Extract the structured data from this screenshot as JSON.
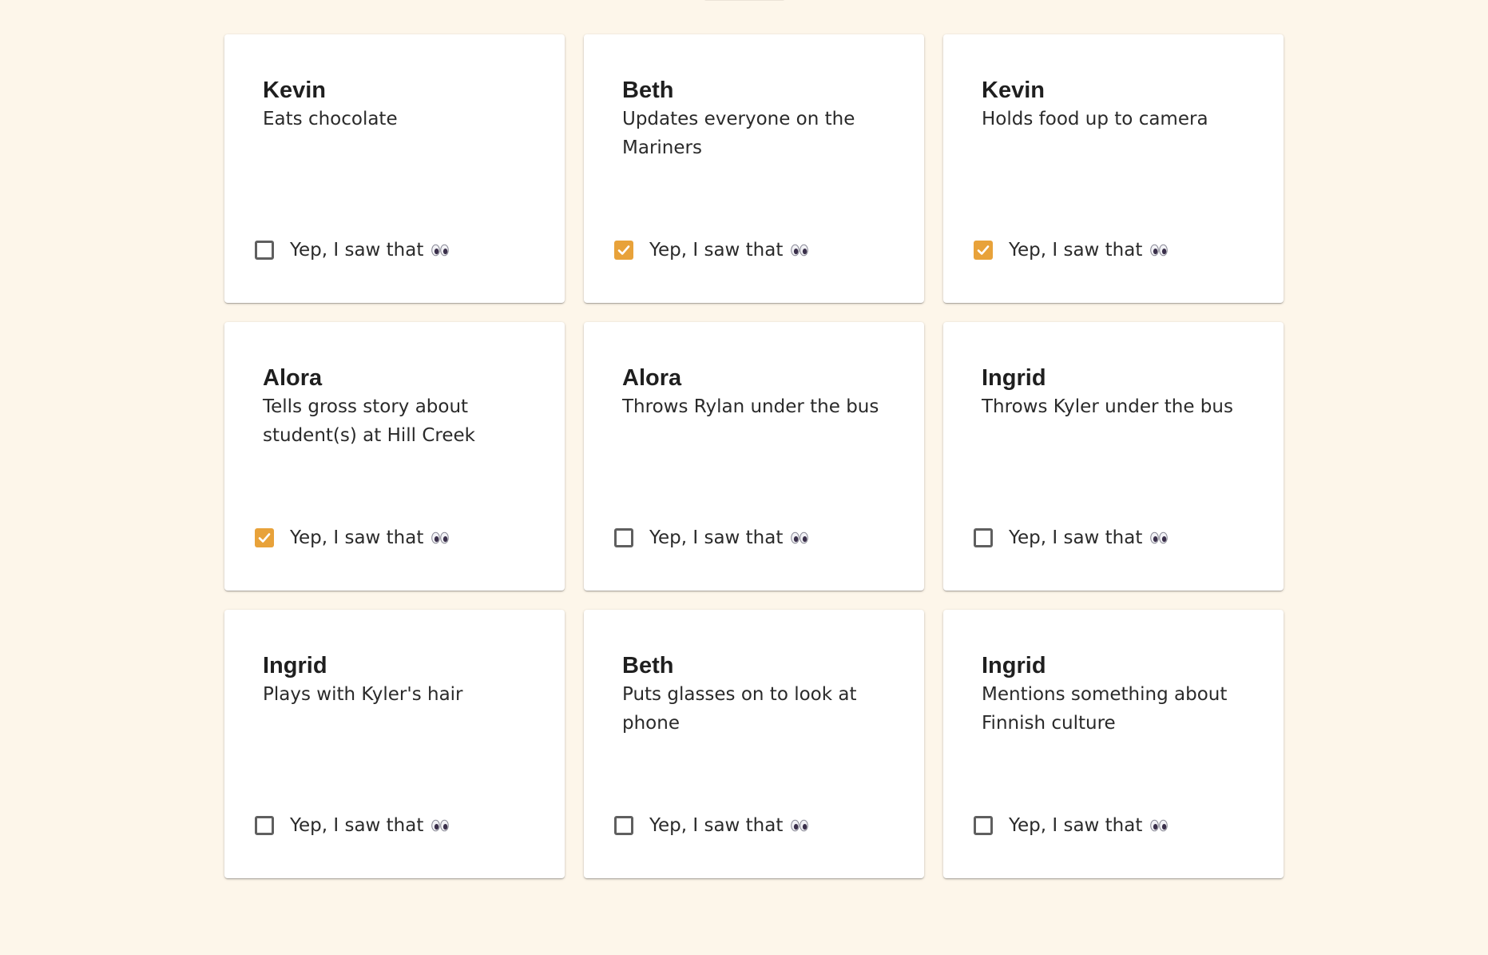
{
  "colors": {
    "background": "#fdf6ea",
    "card": "#ffffff",
    "accent_checked": "#e8a23a",
    "checkbox_border": "#5f5f5f",
    "text": "#222222"
  },
  "check_label": "Yep, I saw that",
  "check_icon": "eyes-icon",
  "cards": [
    {
      "name": "Kevin",
      "description": "Eats chocolate",
      "checked": false
    },
    {
      "name": "Beth",
      "description": "Updates everyone on the Mariners",
      "checked": true
    },
    {
      "name": "Kevin",
      "description": "Holds food up to camera",
      "checked": true
    },
    {
      "name": "Alora",
      "description": "Tells gross story about student(s) at Hill Creek",
      "checked": true
    },
    {
      "name": "Alora",
      "description": "Throws Rylan under the bus",
      "checked": false
    },
    {
      "name": "Ingrid",
      "description": "Throws Kyler under the bus",
      "checked": false
    },
    {
      "name": "Ingrid",
      "description": "Plays with Kyler's hair",
      "checked": false
    },
    {
      "name": "Beth",
      "description": "Puts glasses on to look at phone",
      "checked": false
    },
    {
      "name": "Ingrid",
      "description": "Mentions something about Finnish culture",
      "checked": false
    }
  ]
}
